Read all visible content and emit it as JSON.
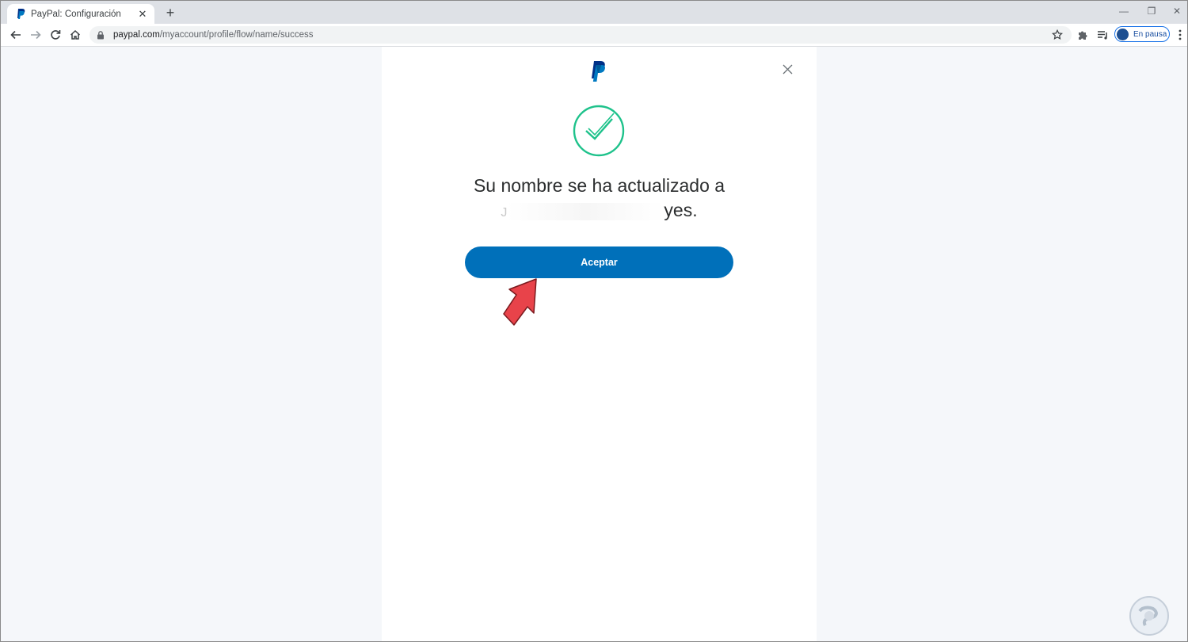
{
  "browser": {
    "tab_title": "PayPal: Configuración",
    "tab_close": "✕",
    "new_tab": "+",
    "url_host": "paypal.com",
    "url_path": "/myaccount/profile/flow/name/success",
    "profile_label": "En pausa",
    "window_controls": {
      "minimize": "—",
      "restore": "❐",
      "close": "✕"
    }
  },
  "dialog": {
    "message_line1": "Su nombre se ha actualizado a",
    "message_line2_visible_start": "J",
    "message_line2_visible_end": "yes.",
    "accept_label": "Aceptar",
    "close_glyph": "✕"
  },
  "colors": {
    "paypal_blue": "#0070ba",
    "paypal_navy": "#003087",
    "success_green": "#1ec28b",
    "annotation_arrow": "#e8434a",
    "page_bg": "#f5f7fa"
  },
  "icons": [
    "paypal-favicon",
    "back-arrow-icon",
    "forward-arrow-icon",
    "reload-icon",
    "home-icon",
    "lock-icon",
    "star-icon",
    "puzzle-icon",
    "playlist-icon",
    "more-menu-icon",
    "paypal-logo",
    "close-icon",
    "success-check-icon",
    "red-pointer-arrow",
    "watermark-logo"
  ]
}
